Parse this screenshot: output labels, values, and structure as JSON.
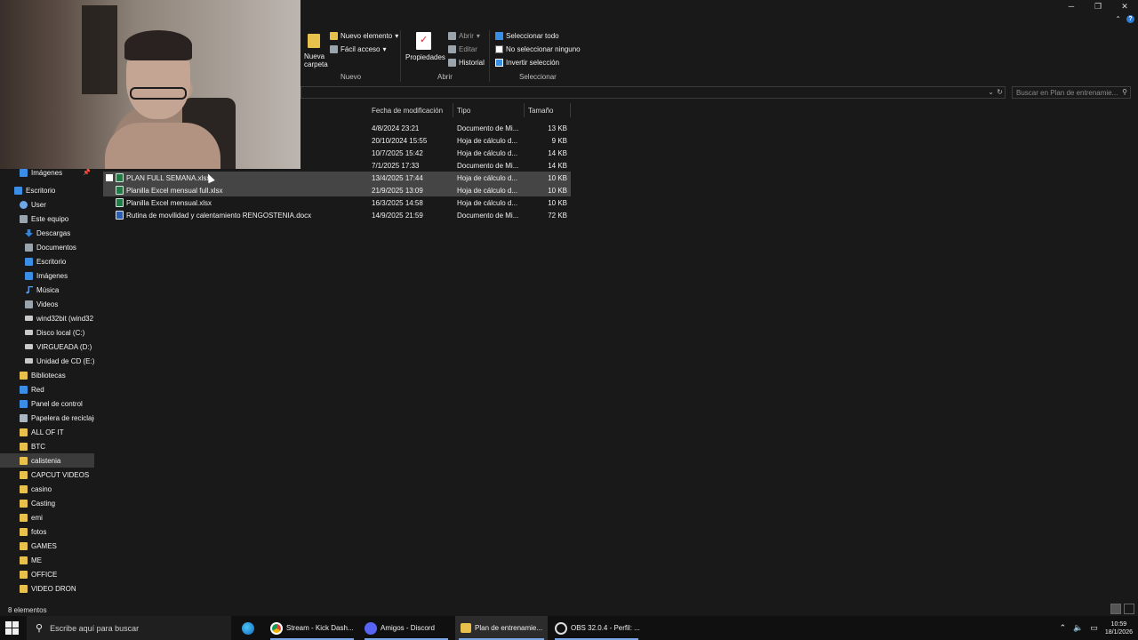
{
  "window": {
    "minimize_icon": "minimize-icon",
    "restore_icon": "restore-icon",
    "close_icon": "close-icon"
  },
  "ribbon": {
    "new_folder": "Nueva carpeta",
    "new_item": "Nuevo elemento",
    "easy_access": "Fácil acceso",
    "group_new": "Nuevo",
    "properties": "Propiedades",
    "open": "Abrir",
    "edit": "Editar",
    "history": "Historial",
    "group_open": "Abrir",
    "select_all": "Seleccionar todo",
    "select_none": "No seleccionar ninguno",
    "invert_selection": "Invertir selección",
    "group_select": "Seleccionar"
  },
  "search": {
    "placeholder": "Buscar en Plan de entrenamie..."
  },
  "columns": {
    "date": "Fecha de modificación",
    "type": "Tipo",
    "size": "Tamaño"
  },
  "files": [
    {
      "name": "",
      "date": "4/8/2024 23:21",
      "type": "Documento de Mi...",
      "size": "13 KB"
    },
    {
      "name": "",
      "date": "20/10/2024 15:55",
      "type": "Hoja de cálculo d...",
      "size": "9 KB"
    },
    {
      "name": "",
      "date": "10/7/2025 15:42",
      "type": "Hoja de cálculo d...",
      "size": "14 KB"
    },
    {
      "name": "",
      "date": "7/1/2025 17:33",
      "type": "Documento de Mi...",
      "size": "14 KB"
    },
    {
      "name": "PLAN FULL SEMANA.xlsx",
      "date": "13/4/2025 17:44",
      "type": "Hoja de cálculo d...",
      "size": "10 KB"
    },
    {
      "name": "Planilla Excel mensual full.xlsx",
      "date": "21/9/2025 13:09",
      "type": "Hoja de cálculo d...",
      "size": "10 KB"
    },
    {
      "name": "Planilla Excel mensual.xlsx",
      "date": "16/3/2025 14:58",
      "type": "Hoja de cálculo d...",
      "size": "10 KB"
    },
    {
      "name": "Rutina de movilidad y calentamiento RENGOSTENIA.docx",
      "date": "14/9/2025 21:59",
      "type": "Documento de Mi...",
      "size": "72 KB"
    }
  ],
  "nav": [
    {
      "label": "Imágenes",
      "icon": "image-icon"
    },
    {
      "label": "Escritorio",
      "icon": "desktop-icon"
    },
    {
      "label": "User",
      "icon": "user-icon"
    },
    {
      "label": "Este equipo",
      "icon": "computer-icon"
    },
    {
      "label": "Descargas",
      "icon": "download-icon"
    },
    {
      "label": "Documentos",
      "icon": "documents-icon"
    },
    {
      "label": "Escritorio",
      "icon": "desktop-icon"
    },
    {
      "label": "Imágenes",
      "icon": "image-icon"
    },
    {
      "label": "Música",
      "icon": "music-icon"
    },
    {
      "label": "Videos",
      "icon": "video-icon"
    },
    {
      "label": "wind32bit (wind32",
      "icon": "drive-icon"
    },
    {
      "label": "Disco local (C:)",
      "icon": "drive-icon"
    },
    {
      "label": "VIRGUEADA (D:)",
      "icon": "drive-icon"
    },
    {
      "label": "Unidad de CD (E:)",
      "icon": "cd-drive-icon"
    },
    {
      "label": "Bibliotecas",
      "icon": "library-icon"
    },
    {
      "label": "Red",
      "icon": "network-icon"
    },
    {
      "label": "Panel de control",
      "icon": "control-panel-icon"
    },
    {
      "label": "Papelera de reciclaje",
      "icon": "recycle-bin-icon"
    },
    {
      "label": "ALL OF IT",
      "icon": "folder-icon"
    },
    {
      "label": "BTC",
      "icon": "folder-icon"
    },
    {
      "label": "calistenia",
      "icon": "folder-icon"
    },
    {
      "label": "CAPCUT VIDEOS",
      "icon": "folder-icon"
    },
    {
      "label": "casino",
      "icon": "folder-icon"
    },
    {
      "label": "Casting",
      "icon": "folder-icon"
    },
    {
      "label": "emi",
      "icon": "folder-icon"
    },
    {
      "label": "fotos",
      "icon": "folder-icon"
    },
    {
      "label": "GAMES",
      "icon": "folder-icon"
    },
    {
      "label": "ME",
      "icon": "folder-icon"
    },
    {
      "label": "OFFICE",
      "icon": "folder-icon"
    },
    {
      "label": "VIDEO DRON",
      "icon": "folder-icon"
    }
  ],
  "status": {
    "count": "8 elementos"
  },
  "taskbar": {
    "search": "Escribe aquí para buscar",
    "apps": [
      {
        "label": "Stream - Kick Dash...",
        "icon": "chrome-icon"
      },
      {
        "label": "Amigos - Discord",
        "icon": "discord-icon"
      },
      {
        "label": "Plan de entrenamie...",
        "icon": "file-explorer-icon"
      },
      {
        "label": "OBS 32.0.4 - Perfil: ...",
        "icon": "obs-icon"
      }
    ],
    "time": "10:59",
    "date": "18/1/2026"
  }
}
